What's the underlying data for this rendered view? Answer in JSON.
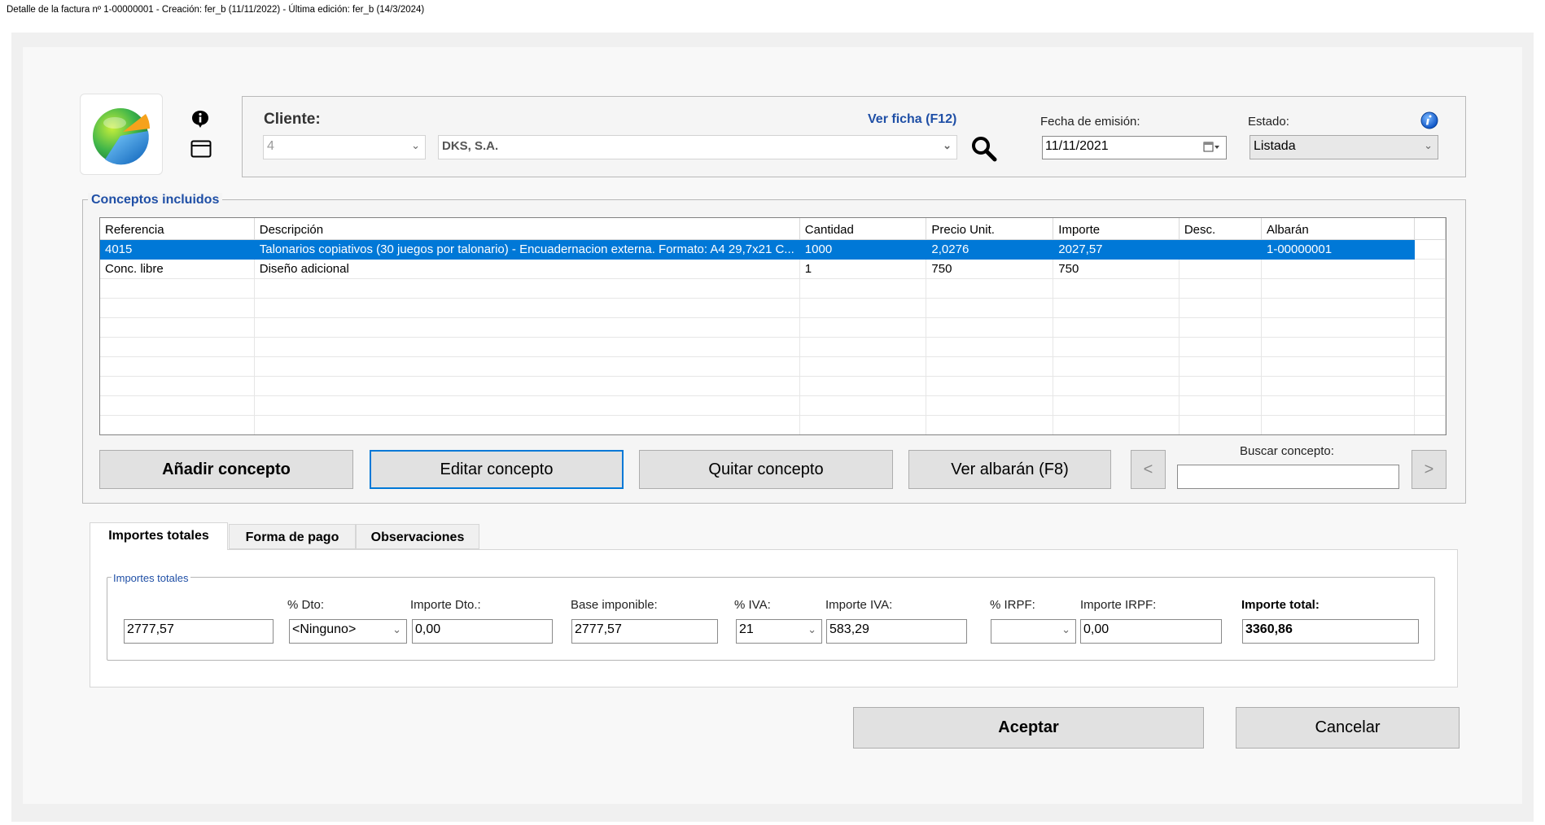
{
  "window": {
    "title": "Detalle de la factura nº 1-00000001 - Creación: fer_b (11/11/2022) - Última edición: fer_b (14/3/2024)"
  },
  "header": {
    "cliente_label": "Cliente:",
    "cliente_id": "4",
    "cliente_nombre": "DKS, S.A.",
    "ver_ficha_link": "Ver ficha (F12)",
    "fecha_label": "Fecha de emisión:",
    "fecha_value": "11/11/2021",
    "estado_label": "Estado:",
    "estado_value": "Listada"
  },
  "conceptos": {
    "group_title": "Conceptos incluidos",
    "columns": [
      "Referencia",
      "Descripción",
      "Cantidad",
      "Precio Unit.",
      "Importe",
      "Desc.",
      "Albarán"
    ],
    "rows": [
      {
        "ref": "4015",
        "desc": "Talonarios copiativos (30 juegos por talonario) - Encuadernacion externa. Formato: A4 29,7x21 C...",
        "cantidad": "1000",
        "precio": "2,0276",
        "importe": "2027,57",
        "descu": "",
        "albaran": "1-00000001",
        "selected": true
      },
      {
        "ref": "Conc. libre",
        "desc": "Diseño adicional",
        "cantidad": "1",
        "precio": "750",
        "importe": "750",
        "descu": "",
        "albaran": "",
        "selected": false
      }
    ],
    "buttons": {
      "anadir": "Añadir concepto",
      "editar": "Editar concepto",
      "quitar": "Quitar concepto",
      "ver_albaran": "Ver albarán (F8)",
      "prev": "<",
      "next": ">"
    },
    "buscar_label": "Buscar concepto:",
    "buscar_value": ""
  },
  "tabs": [
    {
      "label": "Importes totales",
      "active": true
    },
    {
      "label": "Forma de pago",
      "active": false
    },
    {
      "label": "Observaciones",
      "active": false
    }
  ],
  "totales": {
    "group_title": "Importes totales",
    "subtotal_value": "2777,57",
    "dto_pct_label": "% Dto:",
    "dto_pct_value": "<Ninguno>",
    "importe_dto_label": "Importe Dto.:",
    "importe_dto_value": "0,00",
    "base_label": "Base imponible:",
    "base_value": "2777,57",
    "iva_pct_label": "% IVA:",
    "iva_pct_value": "21",
    "importe_iva_label": "Importe IVA:",
    "importe_iva_value": "583,29",
    "irpf_pct_label": "% IRPF:",
    "irpf_pct_value": "",
    "importe_irpf_label": "Importe IRPF:",
    "importe_irpf_value": "0,00",
    "total_label": "Importe total:",
    "total_value": "3360,86"
  },
  "footer": {
    "aceptar": "Aceptar",
    "cancelar": "Cancelar"
  },
  "colors": {
    "accent": "#0078d7",
    "link": "#1f4fa6",
    "button_bg": "#e1e1e1"
  }
}
